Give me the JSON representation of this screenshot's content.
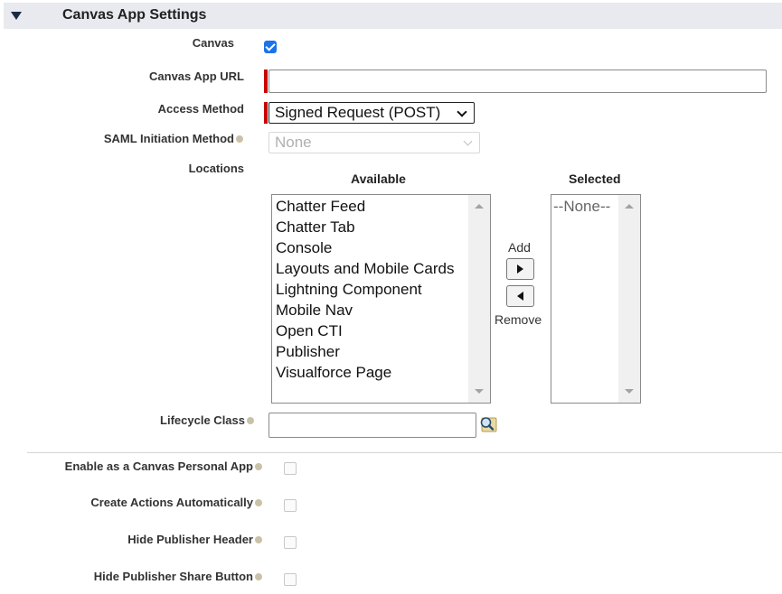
{
  "section": {
    "title": "Canvas App Settings"
  },
  "fields": {
    "canvas": {
      "label": "Canvas",
      "checked": true
    },
    "canvas_app_url": {
      "label": "Canvas App URL",
      "value": ""
    },
    "access_method": {
      "label": "Access Method",
      "value": "Signed Request (POST)"
    },
    "saml_initiation_method": {
      "label": "SAML Initiation Method",
      "value": "None"
    },
    "locations": {
      "label": "Locations",
      "available_header": "Available",
      "selected_header": "Selected",
      "available": [
        "Chatter Feed",
        "Chatter Tab",
        "Console",
        "Layouts and Mobile Cards",
        "Lightning Component",
        "Mobile Nav",
        "Open CTI",
        "Publisher",
        "Visualforce Page"
      ],
      "selected": [
        "--None--"
      ],
      "add_label": "Add",
      "remove_label": "Remove"
    },
    "lifecycle_class": {
      "label": "Lifecycle Class",
      "value": ""
    }
  },
  "options": {
    "personal_app": {
      "label": "Enable as a Canvas Personal App",
      "checked": false
    },
    "create_actions": {
      "label": "Create Actions Automatically",
      "checked": false
    },
    "hide_publisher_header": {
      "label": "Hide Publisher Header",
      "checked": false
    },
    "hide_publisher_share": {
      "label": "Hide Publisher Share Button",
      "checked": false
    }
  },
  "colors": {
    "accent": "#1a73e8",
    "required": "#cc0000",
    "header_bg": "#e8eaf0"
  }
}
